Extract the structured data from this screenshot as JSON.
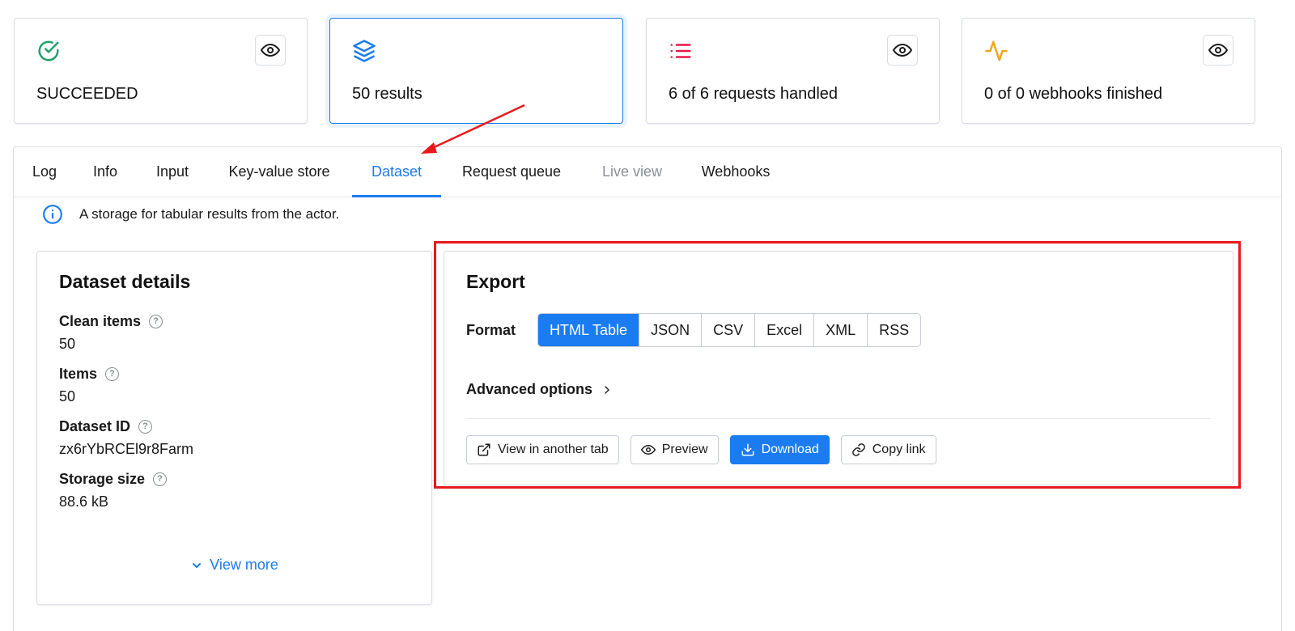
{
  "stats": [
    {
      "text": "SUCCEEDED",
      "icon": "check-circle-icon",
      "color": "#22a06b"
    },
    {
      "text": "50 results",
      "icon": "layers-icon",
      "color": "#1a7cf0"
    },
    {
      "text": "6 of 6 requests handled",
      "icon": "list-icon",
      "color": "#e8194b"
    },
    {
      "text": "0 of 0 webhooks finished",
      "icon": "activity-icon",
      "color": "#f2a516"
    }
  ],
  "tabs": [
    {
      "label": "Log"
    },
    {
      "label": "Info"
    },
    {
      "label": "Input"
    },
    {
      "label": "Key-value store"
    },
    {
      "label": "Dataset",
      "active": true
    },
    {
      "label": "Request queue"
    },
    {
      "label": "Live view",
      "disabled": true
    },
    {
      "label": "Webhooks"
    }
  ],
  "info_text": "A storage for tabular results from the actor.",
  "details": {
    "title": "Dataset details",
    "fields": [
      {
        "label": "Clean items",
        "value": "50"
      },
      {
        "label": "Items",
        "value": "50"
      },
      {
        "label": "Dataset ID",
        "value": "zx6rYbRCEl9r8Farm"
      },
      {
        "label": "Storage size",
        "value": "88.6 kB"
      }
    ],
    "view_more": "View more"
  },
  "export": {
    "title": "Export",
    "format_label": "Format",
    "formats": [
      "HTML Table",
      "JSON",
      "CSV",
      "Excel",
      "XML",
      "RSS"
    ],
    "selected_format": "HTML Table",
    "advanced_label": "Advanced options",
    "actions": [
      {
        "label": "View in another tab",
        "icon": "external-link-icon"
      },
      {
        "label": "Preview",
        "icon": "eye-icon"
      },
      {
        "label": "Download",
        "icon": "download-icon",
        "primary": true
      },
      {
        "label": "Copy link",
        "icon": "link-icon"
      }
    ]
  },
  "colors": {
    "accent": "#1a7cf0",
    "annotation": "#e8191d"
  }
}
